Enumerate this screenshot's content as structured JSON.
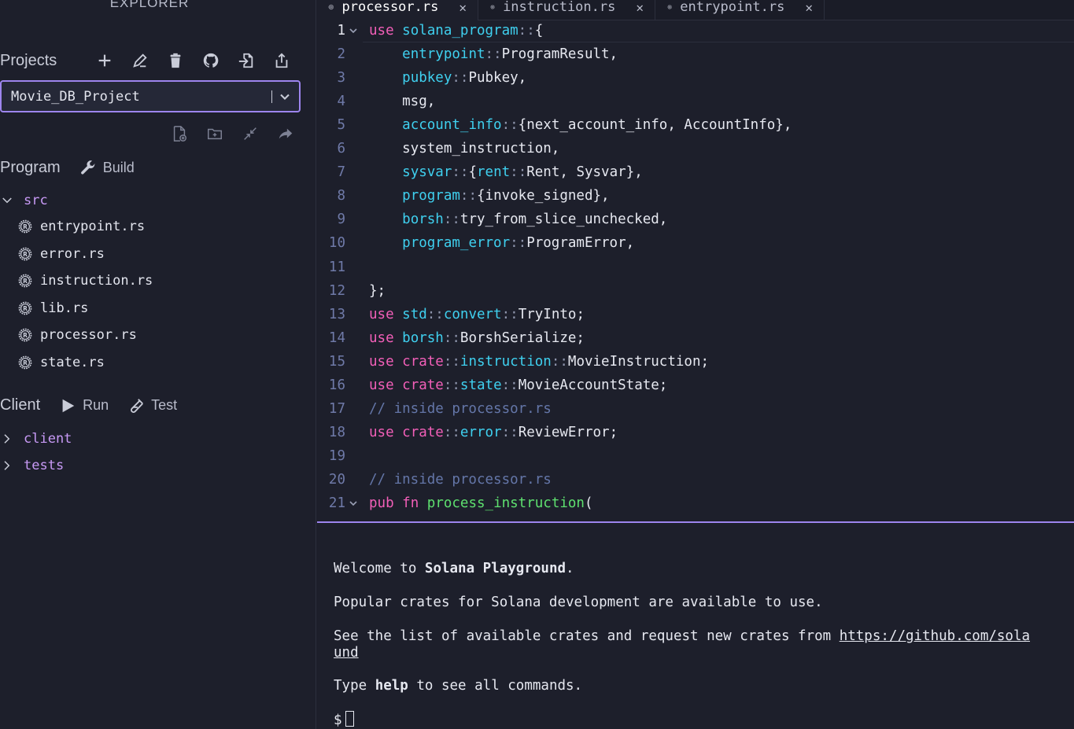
{
  "explorer": {
    "title": "EXPLORER"
  },
  "projects": {
    "label": "Projects",
    "selected_project": "Movie_DB_Project",
    "tools": [
      "plus-icon",
      "rename-icon",
      "trash-icon",
      "github-icon",
      "import-icon",
      "export-icon"
    ]
  },
  "file_tools": [
    "new-file-icon",
    "new-folder-icon",
    "collapse-icon",
    "share-icon"
  ],
  "program": {
    "label": "Program",
    "build_label": "Build",
    "folder": "src",
    "files": [
      "entrypoint.rs",
      "error.rs",
      "instruction.rs",
      "lib.rs",
      "processor.rs",
      "state.rs"
    ]
  },
  "client": {
    "label": "Client",
    "run_label": "Run",
    "test_label": "Test",
    "folders": [
      "client",
      "tests"
    ]
  },
  "tabs": [
    {
      "label": "processor.rs",
      "active": true
    },
    {
      "label": "instruction.rs",
      "active": false
    },
    {
      "label": "entrypoint.rs",
      "active": false
    }
  ],
  "editor": {
    "current_line": 1,
    "lines": [
      {
        "n": "1",
        "fold": true,
        "tokens": [
          [
            "kw",
            "use"
          ],
          [
            "pl",
            " "
          ],
          [
            "ns",
            "solana_program"
          ],
          [
            "op",
            "::"
          ],
          [
            "pl",
            "{"
          ]
        ]
      },
      {
        "n": "2",
        "tokens": [
          [
            "pl",
            "    "
          ],
          [
            "ns",
            "entrypoint"
          ],
          [
            "op",
            "::"
          ],
          [
            "pl",
            "ProgramResult,"
          ]
        ]
      },
      {
        "n": "3",
        "tokens": [
          [
            "pl",
            "    "
          ],
          [
            "ns",
            "pubkey"
          ],
          [
            "op",
            "::"
          ],
          [
            "pl",
            "Pubkey,"
          ]
        ]
      },
      {
        "n": "4",
        "tokens": [
          [
            "pl",
            "    msg,"
          ]
        ]
      },
      {
        "n": "5",
        "tokens": [
          [
            "pl",
            "    "
          ],
          [
            "ns",
            "account_info"
          ],
          [
            "op",
            "::"
          ],
          [
            "pl",
            "{next_account_info, AccountInfo},"
          ]
        ]
      },
      {
        "n": "6",
        "tokens": [
          [
            "pl",
            "    system_instruction,"
          ]
        ]
      },
      {
        "n": "7",
        "tokens": [
          [
            "pl",
            "    "
          ],
          [
            "ns",
            "sysvar"
          ],
          [
            "op",
            "::"
          ],
          [
            "pl",
            "{"
          ],
          [
            "ns",
            "rent"
          ],
          [
            "op",
            "::"
          ],
          [
            "pl",
            "Rent, Sysvar},"
          ]
        ]
      },
      {
        "n": "8",
        "tokens": [
          [
            "pl",
            "    "
          ],
          [
            "ns",
            "program"
          ],
          [
            "op",
            "::"
          ],
          [
            "pl",
            "{invoke_signed},"
          ]
        ]
      },
      {
        "n": "9",
        "tokens": [
          [
            "pl",
            "    "
          ],
          [
            "ns",
            "borsh"
          ],
          [
            "op",
            "::"
          ],
          [
            "pl",
            "try_from_slice_unchecked,"
          ]
        ]
      },
      {
        "n": "10",
        "tokens": [
          [
            "pl",
            "    "
          ],
          [
            "ns",
            "program_error"
          ],
          [
            "op",
            "::"
          ],
          [
            "pl",
            "ProgramError,"
          ]
        ]
      },
      {
        "n": "11",
        "tokens": []
      },
      {
        "n": "12",
        "tokens": [
          [
            "pl",
            "};"
          ]
        ]
      },
      {
        "n": "13",
        "tokens": [
          [
            "kw",
            "use"
          ],
          [
            "pl",
            " "
          ],
          [
            "ns",
            "std"
          ],
          [
            "op",
            "::"
          ],
          [
            "ns",
            "convert"
          ],
          [
            "op",
            "::"
          ],
          [
            "pl",
            "TryInto;"
          ]
        ]
      },
      {
        "n": "14",
        "tokens": [
          [
            "kw",
            "use"
          ],
          [
            "pl",
            " "
          ],
          [
            "ns",
            "borsh"
          ],
          [
            "op",
            "::"
          ],
          [
            "pl",
            "BorshSerialize;"
          ]
        ]
      },
      {
        "n": "15",
        "tokens": [
          [
            "kw",
            "use"
          ],
          [
            "pl",
            " "
          ],
          [
            "kw",
            "crate"
          ],
          [
            "op",
            "::"
          ],
          [
            "ns",
            "instruction"
          ],
          [
            "op",
            "::"
          ],
          [
            "pl",
            "MovieInstruction;"
          ]
        ]
      },
      {
        "n": "16",
        "tokens": [
          [
            "kw",
            "use"
          ],
          [
            "pl",
            " "
          ],
          [
            "kw",
            "crate"
          ],
          [
            "op",
            "::"
          ],
          [
            "ns",
            "state"
          ],
          [
            "op",
            "::"
          ],
          [
            "pl",
            "MovieAccountState;"
          ]
        ]
      },
      {
        "n": "17",
        "tokens": [
          [
            "cm",
            "// inside processor.rs"
          ]
        ]
      },
      {
        "n": "18",
        "tokens": [
          [
            "kw",
            "use"
          ],
          [
            "pl",
            " "
          ],
          [
            "kw",
            "crate"
          ],
          [
            "op",
            "::"
          ],
          [
            "ns",
            "error"
          ],
          [
            "op",
            "::"
          ],
          [
            "pl",
            "ReviewError;"
          ]
        ]
      },
      {
        "n": "19",
        "tokens": []
      },
      {
        "n": "20",
        "tokens": [
          [
            "cm",
            "// inside processor.rs"
          ]
        ]
      },
      {
        "n": "21",
        "fold": true,
        "tokens": [
          [
            "kw",
            "pub"
          ],
          [
            "pl",
            " "
          ],
          [
            "kw",
            "fn"
          ],
          [
            "pl",
            " "
          ],
          [
            "fn",
            "process_instruction"
          ],
          [
            "pl",
            "("
          ]
        ]
      }
    ]
  },
  "terminal": {
    "welcome_prefix": "Welcome to ",
    "welcome_bold": "Solana Playground",
    "welcome_suffix": ".",
    "crates_line": "Popular crates for Solana development are available to use.",
    "list_prefix": "See the list of available crates and request new crates from ",
    "list_link": "https://github.com/sola",
    "list_link_wrap": "und",
    "help_prefix": "Type ",
    "help_bold": "help",
    "help_suffix": " to see all commands.",
    "prompt": "$"
  }
}
